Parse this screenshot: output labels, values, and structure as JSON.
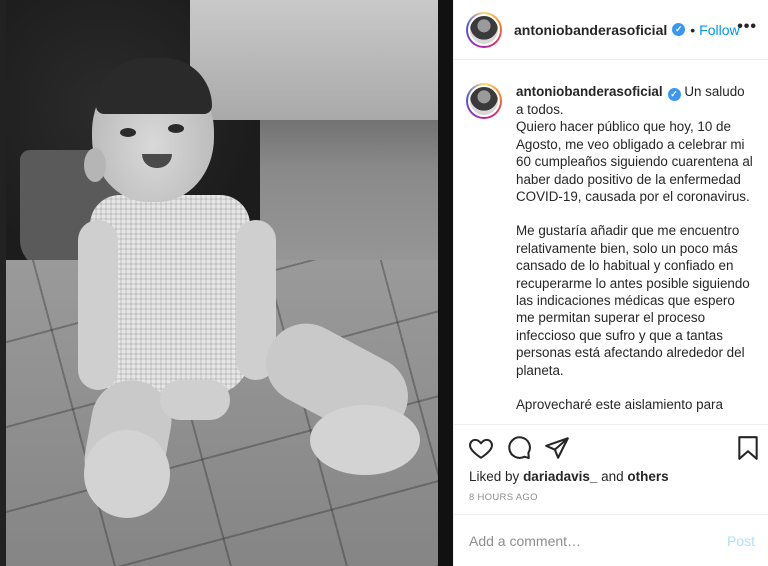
{
  "header": {
    "username": "antoniobanderasoficial",
    "separator": "•",
    "follow_label": "Follow",
    "more_label": "•••"
  },
  "caption": {
    "username": "antoniobanderasoficial",
    "paragraphs": [
      "Un saludo a todos.\nQuiero hacer público que hoy, 10 de Agosto, me veo obligado a celebrar mi 60 cumpleaños siguiendo cuarentena al haber dado positivo de la enfermedad COVID-19, causada por el coronavirus.",
      "Me gustaría añadir que me encuentro relativamente bien, solo un poco más cansado de lo habitual y confiado en recuperarme lo antes posible siguiendo las indicaciones médicas que espero me permitan superar el proceso infeccioso que sufro y que a tantas personas está afectando alrededor del planeta.",
      "Aprovecharé este aislamiento para"
    ]
  },
  "actions": {
    "icons": [
      "heart-icon",
      "comment-icon",
      "share-icon",
      "bookmark-icon"
    ]
  },
  "likes": {
    "prefix": "Liked by",
    "user": "dariadavis_",
    "conjunction": "and",
    "others": "others"
  },
  "timestamp": "8 HOURS AGO",
  "comment": {
    "placeholder": "Add a comment…",
    "post_label": "Post"
  },
  "colors": {
    "accent": "#0095f6",
    "verified": "#3897f0",
    "post_disabled": "#b2dffc",
    "muted": "#8e8e8e",
    "text": "#262626"
  }
}
